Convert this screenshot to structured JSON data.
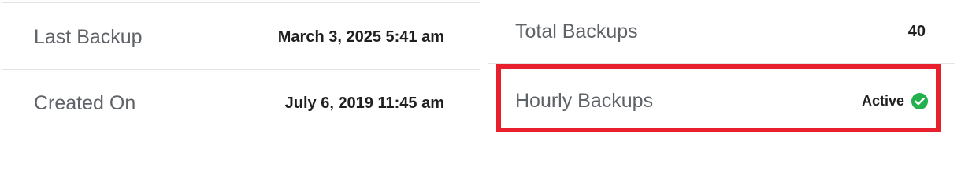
{
  "left": {
    "rows": [
      {
        "label": "Last Backup",
        "value": "March 3, 2025 5:41 am"
      },
      {
        "label": "Created On",
        "value": "July 6, 2019 11:45 am"
      }
    ]
  },
  "right": {
    "rows": [
      {
        "label": "Total Backups",
        "value": "40"
      },
      {
        "label": "Hourly Backups",
        "status": "Active",
        "status_icon": "check-circle-icon"
      }
    ]
  },
  "colors": {
    "highlight_border": "#e8202e",
    "status_green": "#22b14c",
    "label_gray": "#5f6368",
    "value_dark": "#1f1f1f",
    "divider": "#e4e4e4"
  }
}
